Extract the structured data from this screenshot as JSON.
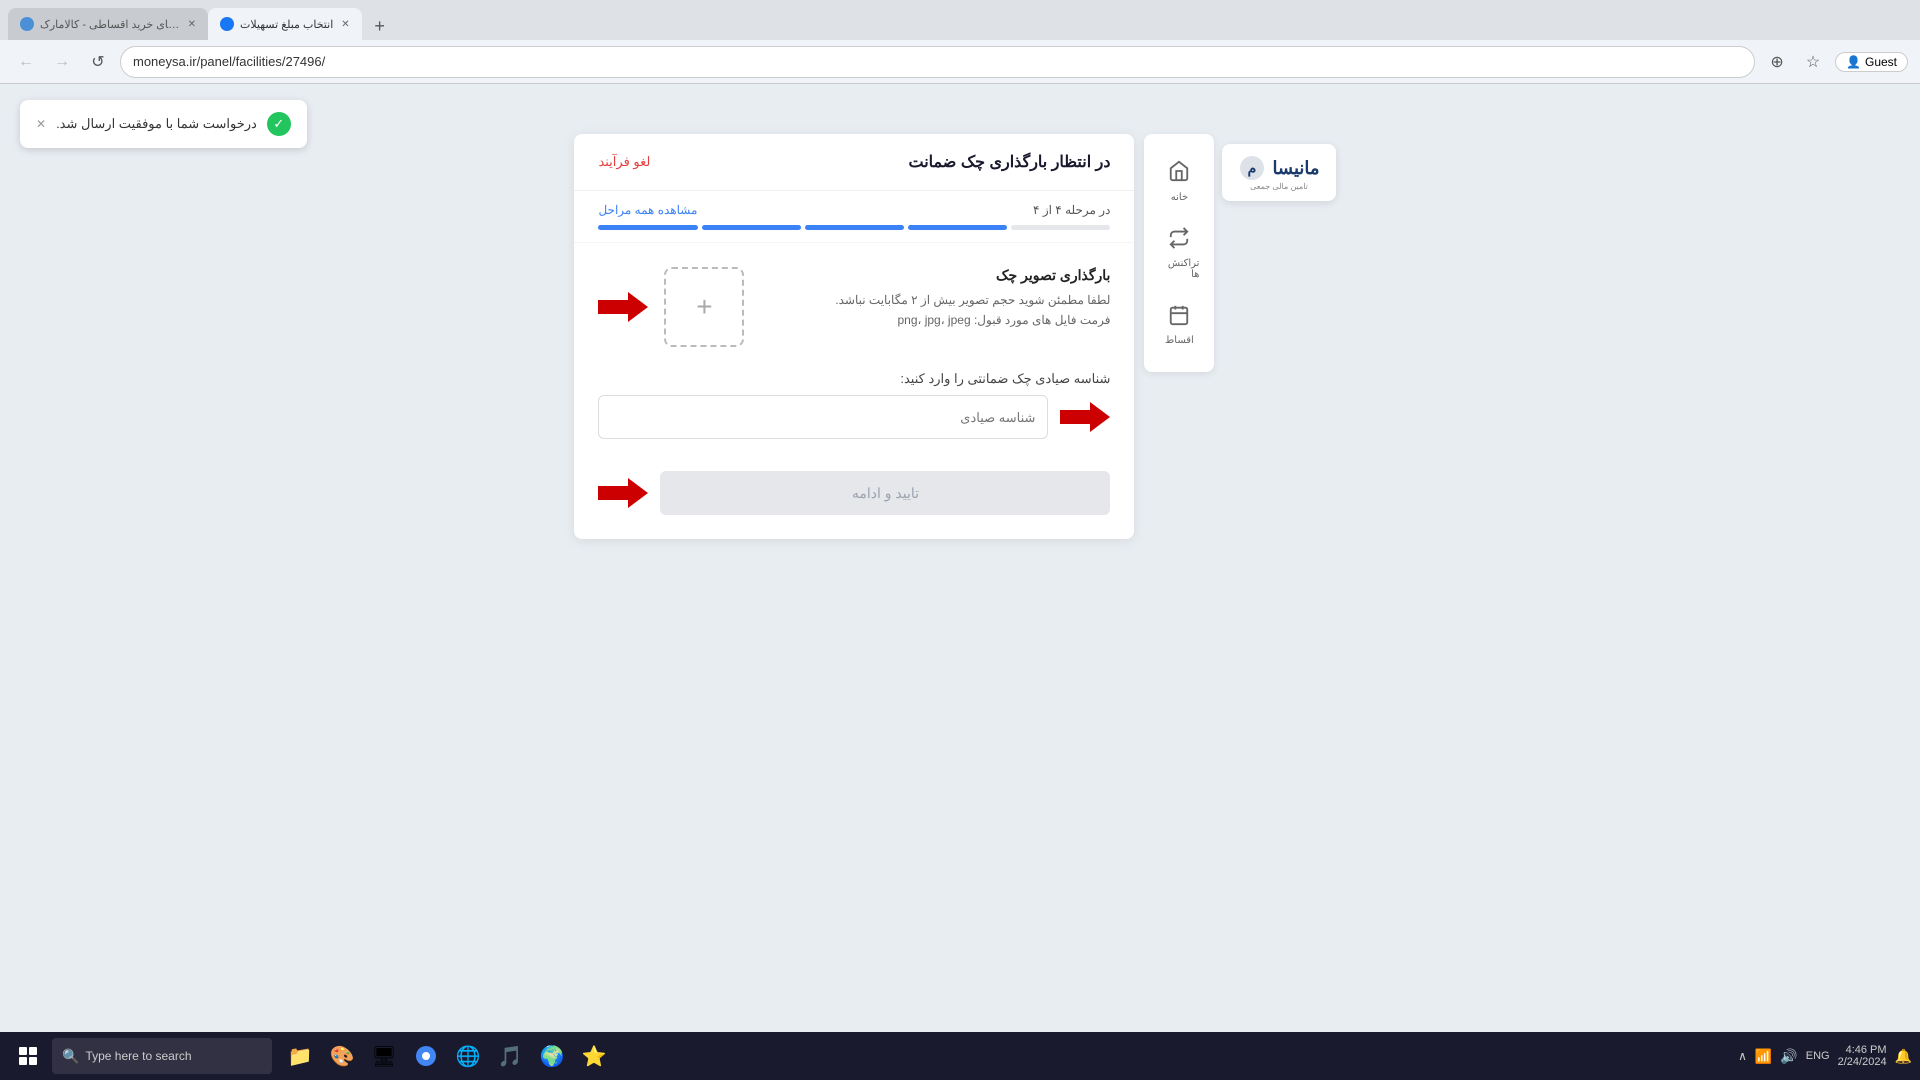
{
  "browser": {
    "tabs": [
      {
        "id": "tab1",
        "label": "راهنمای خرید اقساطی - کالامارک",
        "favicon_color": "#4a90d9",
        "active": false
      },
      {
        "id": "tab2",
        "label": "انتخاب مبلغ تسهیلات",
        "favicon_color": "#1877f2",
        "active": true
      }
    ],
    "new_tab_label": "+",
    "address": "moneysa.ir/panel/facilities/27496/",
    "nav": {
      "back": "←",
      "forward": "→",
      "reload": "↺"
    },
    "profile_label": "Guest"
  },
  "notification": {
    "text": "درخواست شما با موفقیت ارسال شد.",
    "close": "✕",
    "icon": "✓"
  },
  "panel": {
    "title": "در انتظار بارگذاری چک ضمانت",
    "cancel_label": "لغو فرآیند",
    "progress": {
      "step_text": "در مرحله ۴ از ۴",
      "view_all": "مشاهده همه مراحل",
      "segments": [
        "done",
        "done",
        "done",
        "done",
        "done"
      ]
    },
    "upload": {
      "title": "بارگذاری تصویر چک",
      "desc_line1": "لطفا مطمئن شوید حجم تصویر بیش از ۲ مگابایت نباشد.",
      "desc_line2": "فرمت فایل های مورد قبول: png، jpg، jpeg",
      "plus": "+"
    },
    "field": {
      "label": "شناسه صیادی چک ضمانتی را وارد کنید:",
      "placeholder": "شناسه صیادی"
    },
    "submit": {
      "label": "تایید و ادامه"
    }
  },
  "sidebar": {
    "items": [
      {
        "icon": "🏠",
        "label": "خانه"
      },
      {
        "icon": "↩",
        "label": "تراکنش ها"
      },
      {
        "icon": "📅",
        "label": "اقساط"
      }
    ]
  },
  "logo": {
    "text": "مانیسا",
    "sub": "تامین مالی جمعی"
  },
  "taskbar": {
    "start_icon": "⊞",
    "search_placeholder": "Type here to search",
    "search_icon": "🔍",
    "time": "4:46 PM",
    "date": "2/24/2024",
    "lang": "ENG",
    "apps": [
      "📁",
      "🎨",
      "🌐",
      "🔵",
      "🟢",
      "🟡",
      "⚡"
    ]
  }
}
